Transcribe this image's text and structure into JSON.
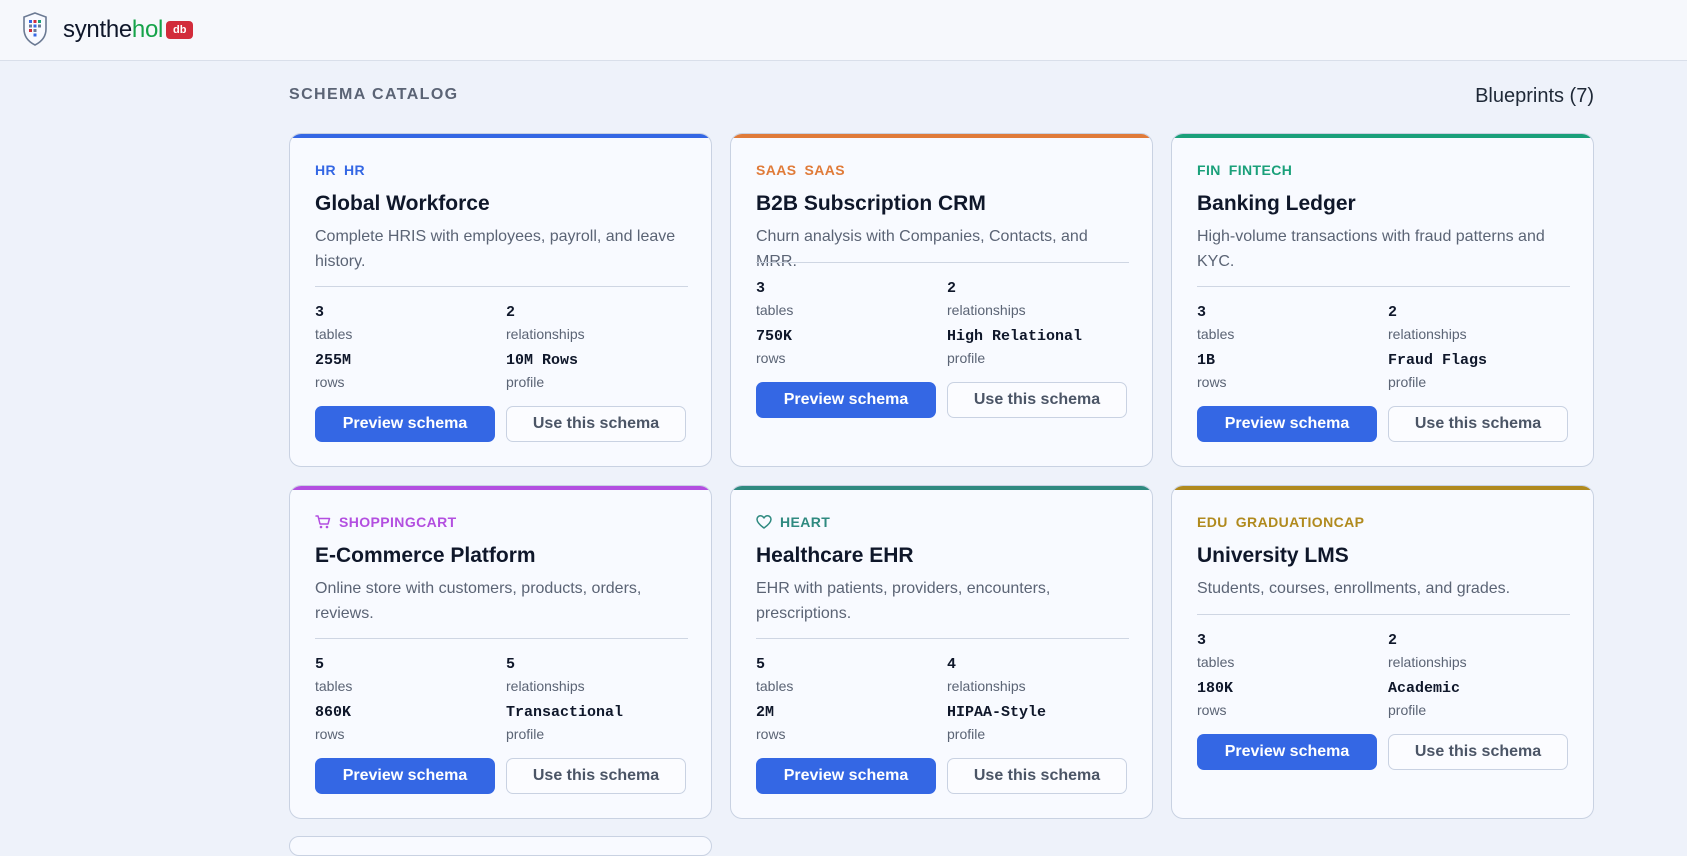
{
  "header": {
    "brand_prefix": "synthe",
    "brand_accent": "hol",
    "badge": "db",
    "logo_icon": "shield-grid-icon"
  },
  "catalog": {
    "title": "SCHEMA CATALOG",
    "count_label": "Blueprints (7)"
  },
  "labels": {
    "tables": "tables",
    "relationships": "relationships",
    "rows": "rows",
    "profile": "profile",
    "preview": "Preview schema",
    "use": "Use this schema"
  },
  "cards": [
    {
      "code": "HR",
      "category": "HR",
      "icon": "",
      "color": "#3467e4",
      "title": "Global Workforce",
      "desc": "Complete HRIS with employees, payroll, and leave history.",
      "tables": "3",
      "relationships": "2",
      "rows": "255M",
      "profile": "10M Rows"
    },
    {
      "code": "SAAS",
      "category": "SAAS",
      "icon": "",
      "color": "#e07b39",
      "title": "B2B Subscription CRM",
      "desc": "Churn analysis with Companies, Contacts, and MRR.",
      "tables": "3",
      "relationships": "2",
      "rows": "750K",
      "profile": "High Relational"
    },
    {
      "code": "FIN",
      "category": "FINTECH",
      "icon": "",
      "color": "#1aa07a",
      "title": "Banking Ledger",
      "desc": "High-volume transactions with fraud patterns and KYC.",
      "tables": "3",
      "relationships": "2",
      "rows": "1B",
      "profile": "Fraud Flags"
    },
    {
      "code": "",
      "category": "SHOPPINGCART",
      "icon": "shopping-cart-icon",
      "color": "#b34fe0",
      "title": "E-Commerce Platform",
      "desc": "Online store with customers, products, orders, reviews.",
      "tables": "5",
      "relationships": "5",
      "rows": "860K",
      "profile": "Transactional"
    },
    {
      "code": "",
      "category": "HEART",
      "icon": "heart-icon",
      "color": "#2f8a80",
      "title": "Healthcare EHR",
      "desc": "EHR with patients, providers, encounters, prescriptions.",
      "tables": "5",
      "relationships": "4",
      "rows": "2M",
      "profile": "HIPAA-Style"
    },
    {
      "code": "EDU",
      "category": "GRADUATIONCAP",
      "icon": "",
      "color": "#b08a1e",
      "title": "University LMS",
      "desc": "Students, courses, enrollments, and grades.",
      "tables": "3",
      "relationships": "2",
      "rows": "180K",
      "profile": "Academic"
    }
  ]
}
